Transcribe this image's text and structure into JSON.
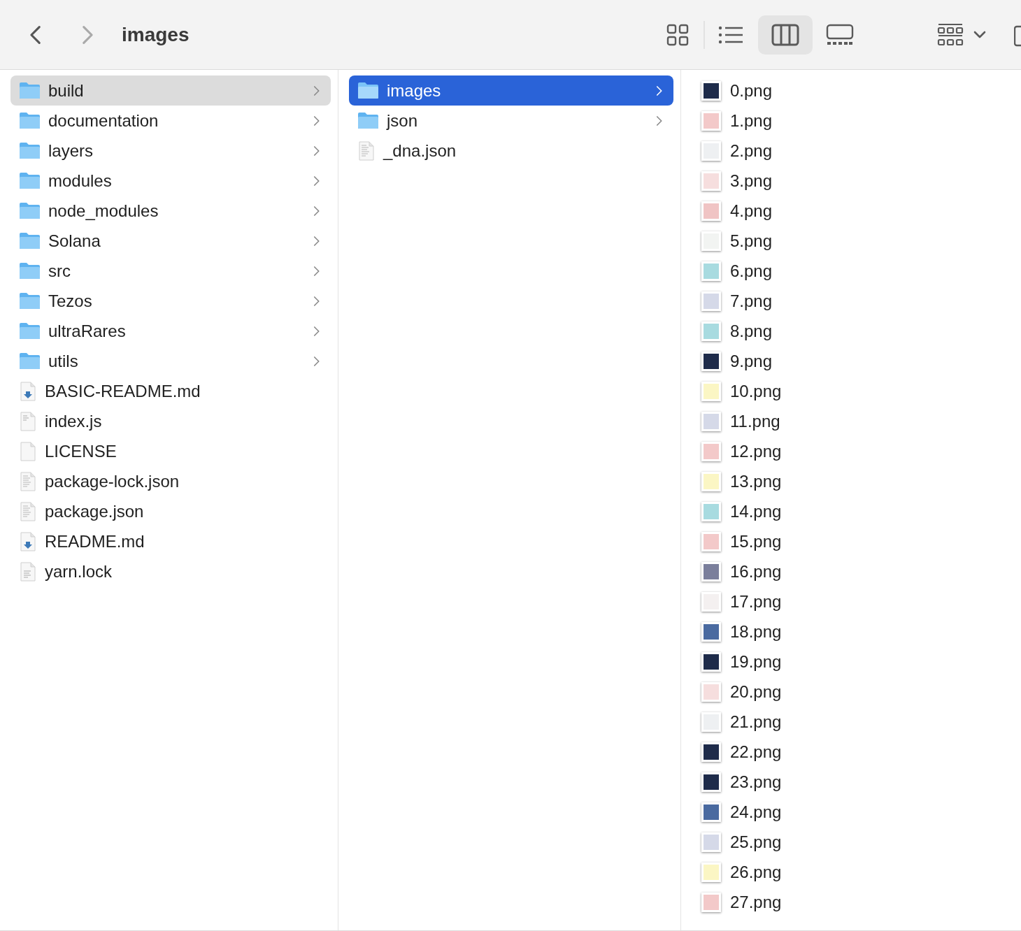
{
  "toolbar": {
    "back": {
      "disabled": false
    },
    "forward": {
      "disabled": true
    },
    "title": "images",
    "view_buttons": [
      {
        "kind": "icons",
        "selected": false
      },
      {
        "kind": "list",
        "selected": false
      },
      {
        "kind": "columns",
        "selected": true
      },
      {
        "kind": "gallery",
        "selected": false
      }
    ]
  },
  "columns": [
    {
      "focused": false,
      "items": [
        {
          "name": "build",
          "kind": "folder",
          "selected": true
        },
        {
          "name": "documentation",
          "kind": "folder",
          "selected": false
        },
        {
          "name": "layers",
          "kind": "folder",
          "selected": false
        },
        {
          "name": "modules",
          "kind": "folder",
          "selected": false
        },
        {
          "name": "node_modules",
          "kind": "folder",
          "selected": false
        },
        {
          "name": "Solana",
          "kind": "folder",
          "selected": false
        },
        {
          "name": "src",
          "kind": "folder",
          "selected": false
        },
        {
          "name": "Tezos",
          "kind": "folder",
          "selected": false
        },
        {
          "name": "ultraRares",
          "kind": "folder",
          "selected": false
        },
        {
          "name": "utils",
          "kind": "folder",
          "selected": false
        },
        {
          "name": "BASIC-README.md",
          "kind": "markdown",
          "selected": false
        },
        {
          "name": "index.js",
          "kind": "script",
          "selected": false
        },
        {
          "name": "LICENSE",
          "kind": "blank",
          "selected": false
        },
        {
          "name": "package-lock.json",
          "kind": "document",
          "selected": false
        },
        {
          "name": "package.json",
          "kind": "document",
          "selected": false
        },
        {
          "name": "README.md",
          "kind": "markdown",
          "selected": false
        },
        {
          "name": "yarn.lock",
          "kind": "text",
          "selected": false
        }
      ]
    },
    {
      "focused": true,
      "items": [
        {
          "name": "images",
          "kind": "folder",
          "selected": true
        },
        {
          "name": "json",
          "kind": "folder",
          "selected": false
        },
        {
          "name": "_dna.json",
          "kind": "document",
          "selected": false
        }
      ]
    },
    {
      "items": [
        {
          "name": "0.png",
          "kind": "image",
          "selected": false,
          "color": "#1e2b4a"
        },
        {
          "name": "1.png",
          "kind": "image",
          "selected": false,
          "color": "#f3c9c9"
        },
        {
          "name": "2.png",
          "kind": "image",
          "selected": false,
          "color": "#eef0f2"
        },
        {
          "name": "3.png",
          "kind": "image",
          "selected": false,
          "color": "#f6dede"
        },
        {
          "name": "4.png",
          "kind": "image",
          "selected": false,
          "color": "#f0c4c4"
        },
        {
          "name": "5.png",
          "kind": "image",
          "selected": false,
          "color": "#f2f4f2"
        },
        {
          "name": "6.png",
          "kind": "image",
          "selected": false,
          "color": "#a8dbe0"
        },
        {
          "name": "7.png",
          "kind": "image",
          "selected": false,
          "color": "#d5d9e8"
        },
        {
          "name": "8.png",
          "kind": "image",
          "selected": false,
          "color": "#a8dbe0"
        },
        {
          "name": "9.png",
          "kind": "image",
          "selected": false,
          "color": "#1e2b4a"
        },
        {
          "name": "10.png",
          "kind": "image",
          "selected": false,
          "color": "#fbf6c4"
        },
        {
          "name": "11.png",
          "kind": "image",
          "selected": false,
          "color": "#d5d9e8"
        },
        {
          "name": "12.png",
          "kind": "image",
          "selected": false,
          "color": "#f3c9c9"
        },
        {
          "name": "13.png",
          "kind": "image",
          "selected": false,
          "color": "#fbf6c4"
        },
        {
          "name": "14.png",
          "kind": "image",
          "selected": false,
          "color": "#a8dbe0"
        },
        {
          "name": "15.png",
          "kind": "image",
          "selected": false,
          "color": "#f3c9c9"
        },
        {
          "name": "16.png",
          "kind": "image",
          "selected": false,
          "color": "#7b7f9c"
        },
        {
          "name": "17.png",
          "kind": "image",
          "selected": false,
          "color": "#f4f0f0"
        },
        {
          "name": "18.png",
          "kind": "image",
          "selected": false,
          "color": "#4a6aa0"
        },
        {
          "name": "19.png",
          "kind": "image",
          "selected": false,
          "color": "#1e2b4a"
        },
        {
          "name": "20.png",
          "kind": "image",
          "selected": false,
          "color": "#f6dede"
        },
        {
          "name": "21.png",
          "kind": "image",
          "selected": false,
          "color": "#eef0f2"
        },
        {
          "name": "22.png",
          "kind": "image",
          "selected": false,
          "color": "#1e2b4a"
        },
        {
          "name": "23.png",
          "kind": "image",
          "selected": false,
          "color": "#1e2b4a"
        },
        {
          "name": "24.png",
          "kind": "image",
          "selected": false,
          "color": "#4a6aa0"
        },
        {
          "name": "25.png",
          "kind": "image",
          "selected": false,
          "color": "#d5d9e8"
        },
        {
          "name": "26.png",
          "kind": "image",
          "selected": false,
          "color": "#fbf6c4"
        },
        {
          "name": "27.png",
          "kind": "image",
          "selected": false,
          "color": "#f3c9c9"
        }
      ]
    }
  ]
}
